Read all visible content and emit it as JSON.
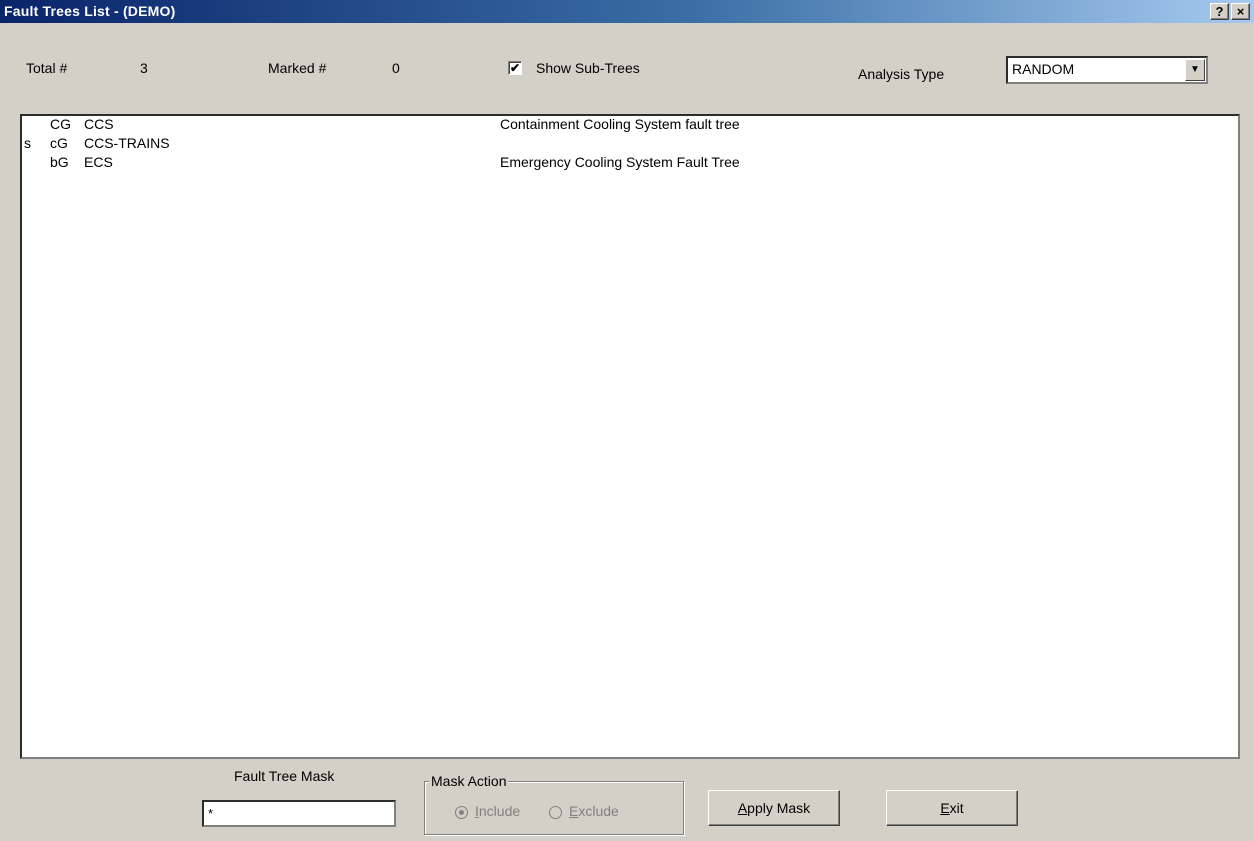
{
  "window": {
    "title": "Fault Trees List  -  (DEMO)",
    "help_button": "?",
    "close_button": "×"
  },
  "header": {
    "total_label": "Total #",
    "total_value": "3",
    "marked_label": "Marked #",
    "marked_value": "0",
    "show_subtrees_label": "Show Sub-Trees",
    "show_subtrees_checked": true,
    "analysis_type_label": "Analysis Type",
    "analysis_type_value": "RANDOM"
  },
  "fault_trees": [
    {
      "flag": "",
      "type": "CG",
      "name": "CCS",
      "description": "Containment Cooling System fault tree"
    },
    {
      "flag": "s",
      "type": "cG",
      "name": "CCS-TRAINS",
      "description": ""
    },
    {
      "flag": "",
      "type": "bG",
      "name": "ECS",
      "description": "Emergency Cooling System Fault Tree"
    }
  ],
  "footer": {
    "mask_label": "Fault Tree Mask",
    "mask_value": "*",
    "mask_action_label": "Mask Action",
    "include_label_accel": "I",
    "include_label_rest": "nclude",
    "exclude_label_accel": "E",
    "exclude_label_rest": "xclude",
    "selected_action": "include",
    "apply_accel": "A",
    "apply_rest": "pply Mask",
    "exit_accel": "E",
    "exit_rest": "xit"
  }
}
